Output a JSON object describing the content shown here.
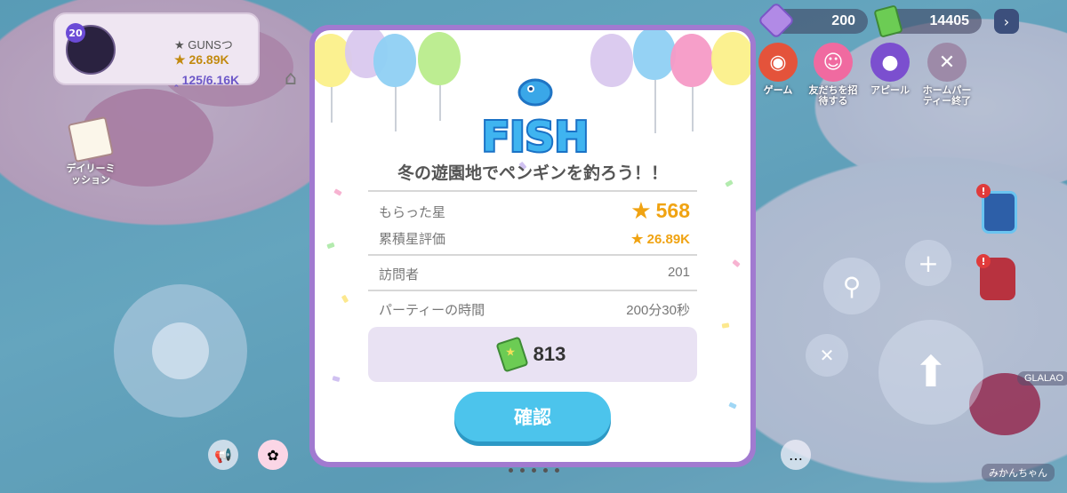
{
  "hud": {
    "player": {
      "level": "20",
      "name": "GUNSつ",
      "stars": "26.89K",
      "followers": "125/6.16K"
    },
    "daily_mission_label": "デイリーミッション",
    "gems": "200",
    "cash": "14405",
    "actions": [
      {
        "label": "ゲーム",
        "icon": "gamepad-icon",
        "color": "#e4533b"
      },
      {
        "label": "友だちを招待する",
        "icon": "smile-icon",
        "color": "#f06aa0"
      },
      {
        "label": "アピール",
        "icon": "balloons-icon",
        "color": "#7b4fcf"
      },
      {
        "label": "ホームパーティー終了",
        "icon": "party-hat-icon",
        "color": "#9d8aa8"
      }
    ],
    "nametags": {
      "left": "GLALAO",
      "right": "みかんちゃん"
    }
  },
  "modal": {
    "logo_text": "FISH",
    "title": "冬の遊園地でペンギンを釣ろう！！",
    "stats": {
      "received_stars_label": "もらった星",
      "received_stars_value": "568",
      "total_rating_label": "累積星評価",
      "total_rating_value": "26.89K",
      "visitors_label": "訪問者",
      "visitors_value": "201",
      "party_time_label": "パーティーの時間",
      "party_time_value": "200分30秒"
    },
    "reward_value": "813",
    "confirm_label": "確認"
  },
  "colors": {
    "modal_border": "#a17ad0",
    "confirm_button": "#4cc4ec",
    "star": "#f0a312",
    "reward_box": "#e9e2f3"
  }
}
